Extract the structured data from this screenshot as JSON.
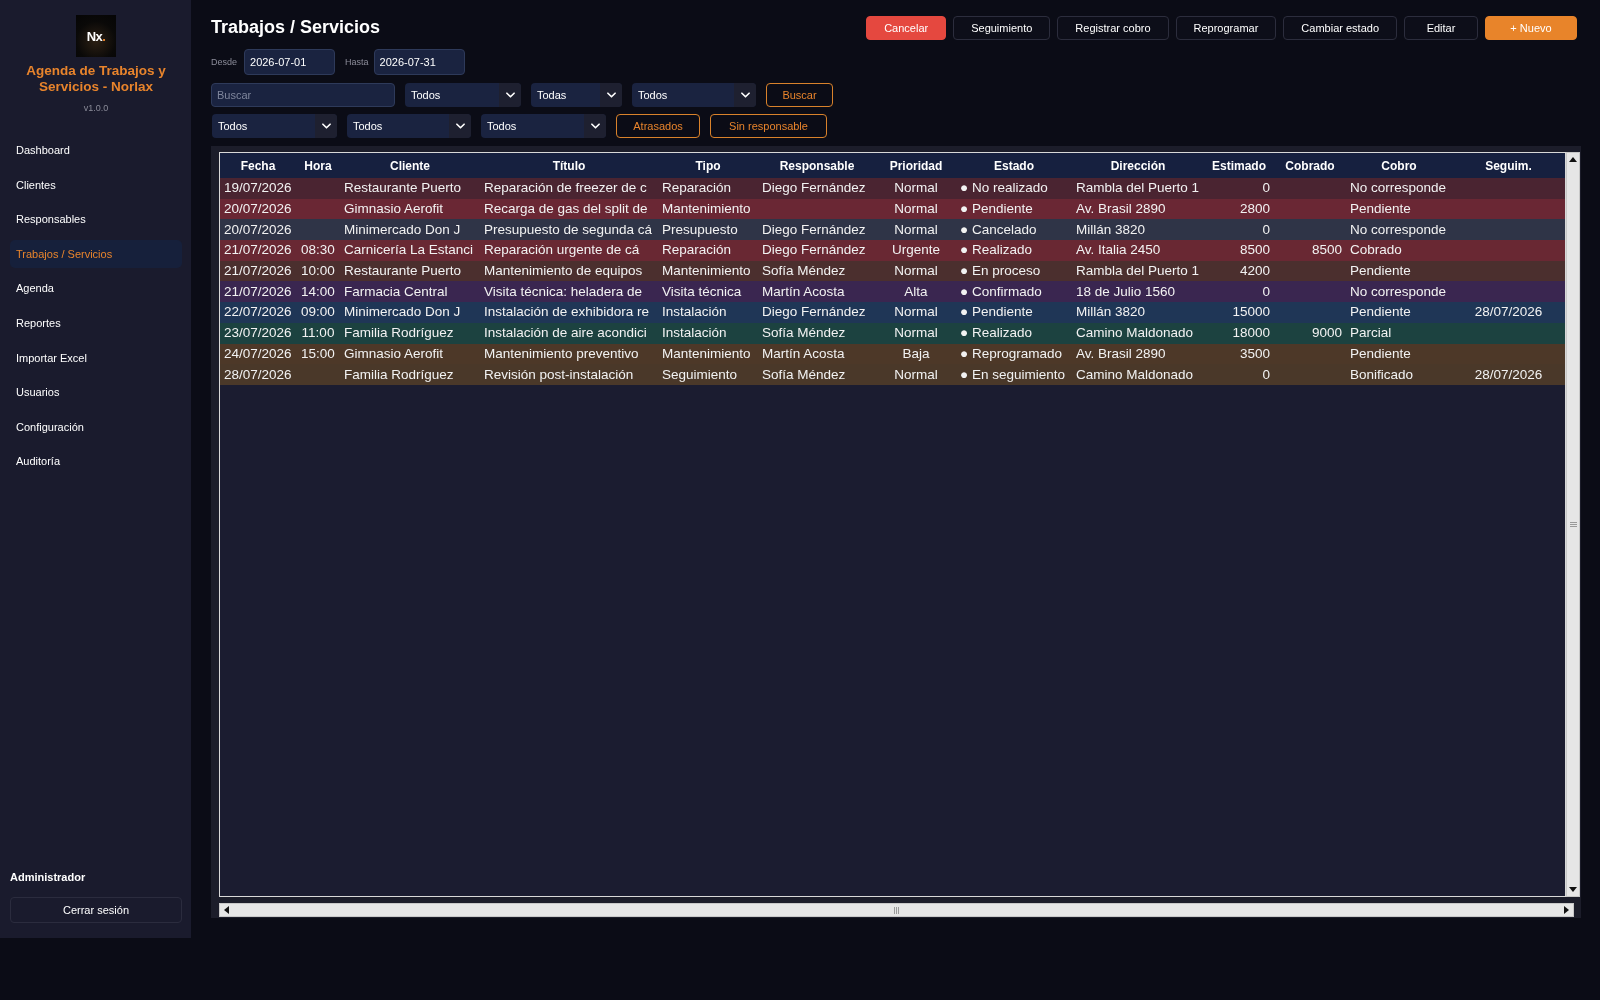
{
  "sidebar": {
    "logo": {
      "letters": "Nx",
      "dot": "."
    },
    "app_title": "Agenda de Trabajos y Servicios - Norlax",
    "version": "v1.0.0",
    "nav": [
      {
        "label": "Dashboard",
        "selected": false
      },
      {
        "label": "Clientes",
        "selected": false
      },
      {
        "label": "Responsables",
        "selected": false
      },
      {
        "label": "Trabajos / Servicios",
        "selected": true
      },
      {
        "label": "Agenda",
        "selected": false
      },
      {
        "label": "Reportes",
        "selected": false
      },
      {
        "label": "Importar Excel",
        "selected": false
      },
      {
        "label": "Usuarios",
        "selected": false
      },
      {
        "label": "Configuración",
        "selected": false
      },
      {
        "label": "Auditoría",
        "selected": false
      }
    ],
    "user": "Administrador",
    "logout_button": "Cerrar sesión"
  },
  "header": {
    "title": "Trabajos / Servicios",
    "actions": [
      {
        "label": "Cancelar",
        "kind": "danger"
      },
      {
        "label": "Seguimiento",
        "kind": "default"
      },
      {
        "label": "Registrar cobro",
        "kind": "default"
      },
      {
        "label": "Reprogramar",
        "kind": "default"
      },
      {
        "label": "Cambiar estado",
        "kind": "default"
      },
      {
        "label": "Editar",
        "kind": "default"
      },
      {
        "label": "+ Nuevo",
        "kind": "primary"
      }
    ]
  },
  "filters": {
    "date_from": {
      "label": "Desde",
      "value": "2026-07-01"
    },
    "date_to": {
      "label": "Hasta",
      "value": "2026-07-31"
    },
    "search": {
      "placeholder": "Buscar"
    },
    "row_1_selects": [
      "Todos",
      "Todas",
      "Todos"
    ],
    "search_button": "Buscar",
    "row_2_selects": [
      "Todos",
      "Todos",
      "Todos"
    ],
    "quick_buttons": [
      "Atrasados",
      "Sin responsable"
    ]
  },
  "table": {
    "columns": [
      "Fecha",
      "Hora",
      "Cliente",
      "Título",
      "Tipo",
      "Responsable",
      "Prioridad",
      "Estado",
      "Dirección",
      "Estimado",
      "Cobrado",
      "Cobro",
      "Seguim."
    ],
    "rows": [
      {
        "color": "#4a2431",
        "fecha": "19/07/2026",
        "cliente": "Restaurante Puerto",
        "titulo": "Reparación de freezer de c",
        "tipo": "Reparación",
        "responsable": "Diego Fernández",
        "prioridad": "Normal",
        "estado": "● No realizado",
        "direccion": "Rambla del Puerto 1",
        "estimado": "0",
        "cobro": "No corresponde"
      },
      {
        "color": "#6a2734",
        "fecha": "20/07/2026",
        "cliente": "Gimnasio Aerofit",
        "titulo": "Recarga de gas del split de",
        "tipo": "Mantenimiento",
        "prioridad": "Normal",
        "estado": "● Pendiente",
        "direccion": "Av. Brasil 2890",
        "estimado": "2800",
        "cobro": "Pendiente"
      },
      {
        "color": "#2f3447",
        "fecha": "20/07/2026",
        "cliente": "Minimercado Don J",
        "titulo": "Presupuesto de segunda cá",
        "tipo": "Presupuesto",
        "responsable": "Diego Fernández",
        "prioridad": "Normal",
        "estado": "● Cancelado",
        "direccion": "Millán 3820",
        "estimado": "0",
        "cobro": "No corresponde"
      },
      {
        "color": "#692833",
        "fecha": "21/07/2026",
        "hora": "08:30",
        "cliente": "Carnicería La Estanci",
        "titulo": "Reparación urgente de cá",
        "tipo": "Reparación",
        "responsable": "Diego Fernández",
        "prioridad": "Urgente",
        "estado": "● Realizado",
        "direccion": "Av. Italia 2450",
        "estimado": "8500",
        "cobrado": "8500",
        "cobro": "Cobrado"
      },
      {
        "color": "#4b2f2e",
        "fecha": "21/07/2026",
        "hora": "10:00",
        "cliente": "Restaurante Puerto",
        "titulo": "Mantenimiento de equipos",
        "tipo": "Mantenimiento",
        "responsable": "Sofía Méndez",
        "prioridad": "Normal",
        "estado": "● En proceso",
        "direccion": "Rambla del Puerto 1",
        "estimado": "4200",
        "cobro": "Pendiente"
      },
      {
        "color": "#3a2650",
        "fecha": "21/07/2026",
        "hora": "14:00",
        "cliente": "Farmacia Central",
        "titulo": "Visita técnica: heladera de",
        "tipo": "Visita técnica",
        "responsable": "Martín Acosta",
        "prioridad": "Alta",
        "estado": "● Confirmado",
        "direccion": "18 de Julio 1560",
        "estimado": "0",
        "cobro": "No corresponde"
      },
      {
        "color": "#1f3656",
        "fecha": "22/07/2026",
        "hora": "09:00",
        "cliente": "Minimercado Don J",
        "titulo": "Instalación de exhibidora re",
        "tipo": "Instalación",
        "responsable": "Diego Fernández",
        "prioridad": "Normal",
        "estado": "● Pendiente",
        "direccion": "Millán 3820",
        "estimado": "15000",
        "cobro": "Pendiente",
        "seguim": "28/07/2026"
      },
      {
        "color": "#1c4240",
        "fecha": "23/07/2026",
        "hora": "11:00",
        "cliente": "Familia Rodríguez",
        "titulo": "Instalación de aire acondici",
        "tipo": "Instalación",
        "responsable": "Sofía Méndez",
        "prioridad": "Normal",
        "estado": "● Realizado",
        "direccion": "Camino Maldonado",
        "estimado": "18000",
        "cobrado": "9000",
        "cobro": "Parcial"
      },
      {
        "color": "#4d3828",
        "fecha": "24/07/2026",
        "hora": "15:00",
        "cliente": "Gimnasio Aerofit",
        "titulo": "Mantenimiento preventivo",
        "tipo": "Mantenimiento",
        "responsable": "Martín Acosta",
        "prioridad": "Baja",
        "estado": "● Reprogramado",
        "direccion": "Av. Brasil 2890",
        "estimado": "3500",
        "cobro": "Pendiente"
      },
      {
        "color": "#4a3829",
        "fecha": "28/07/2026",
        "cliente": "Familia Rodríguez",
        "titulo": "Revisión post-instalación",
        "tipo": "Seguimiento",
        "responsable": "Sofía Méndez",
        "prioridad": "Normal",
        "estado": "● En seguimiento",
        "direccion": "Camino Maldonado",
        "estimado": "0",
        "cobro": "Bonificado",
        "seguim": "28/07/2026"
      }
    ]
  }
}
